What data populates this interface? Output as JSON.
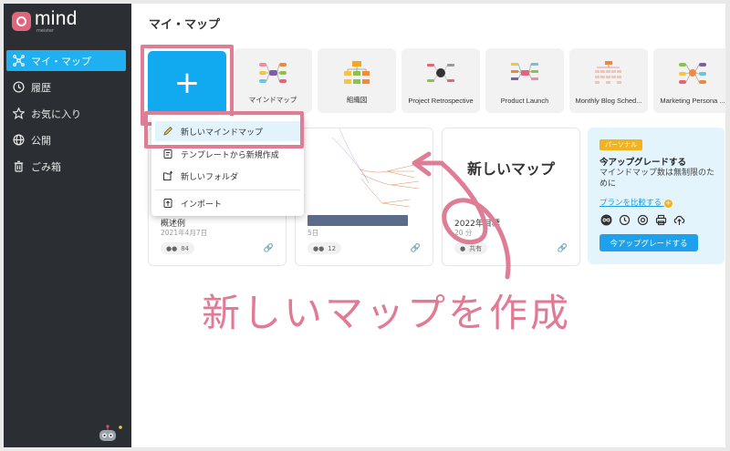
{
  "brand": {
    "name": "mind",
    "sub": "meister"
  },
  "sidebar": {
    "items": [
      {
        "label": "マイ・マップ",
        "icon": "mindmap-icon",
        "active": true
      },
      {
        "label": "履歴",
        "icon": "clock-icon"
      },
      {
        "label": "お気に入り",
        "icon": "star-icon"
      },
      {
        "label": "公開",
        "icon": "globe-icon"
      },
      {
        "label": "ごみ箱",
        "icon": "trash-icon"
      }
    ]
  },
  "main": {
    "title": "マイ・マップ"
  },
  "templates": [
    {
      "label": "マインドマップ"
    },
    {
      "label": "組織図"
    },
    {
      "label": "Project Retrospective"
    },
    {
      "label": "Product Launch"
    },
    {
      "label": "Monthly Blog Sched..."
    },
    {
      "label": "Marketing Persona ..."
    }
  ],
  "new_menu": {
    "items": [
      {
        "label": "新しいマインドマップ",
        "icon": "pencil-icon"
      },
      {
        "label": "テンプレートから新規作成",
        "icon": "template-icon"
      },
      {
        "label": "新しいフォルダ",
        "icon": "folder-plus-icon"
      },
      {
        "label": "インポート",
        "icon": "import-icon"
      }
    ]
  },
  "cards": [
    {
      "title": "概述例",
      "date": "2021年4月7日",
      "badge": "84"
    },
    {
      "title": "",
      "date": "5日",
      "badge": "12"
    },
    {
      "title": "2022年目標",
      "date": "20 分",
      "badge": "共有",
      "thumb_text": "新しいマップ"
    }
  ],
  "promo": {
    "pill": "パーソナル",
    "title": "今アップグレードする",
    "desc": "マインドマップ数は無制限のために",
    "link": "プランを比較する",
    "button": "今アップグレードする"
  },
  "annotation": "新しいマップを作成",
  "colors": {
    "accent": "#1eb0f0",
    "highlight": "#e07d96",
    "sidebar": "#2b2f33"
  }
}
